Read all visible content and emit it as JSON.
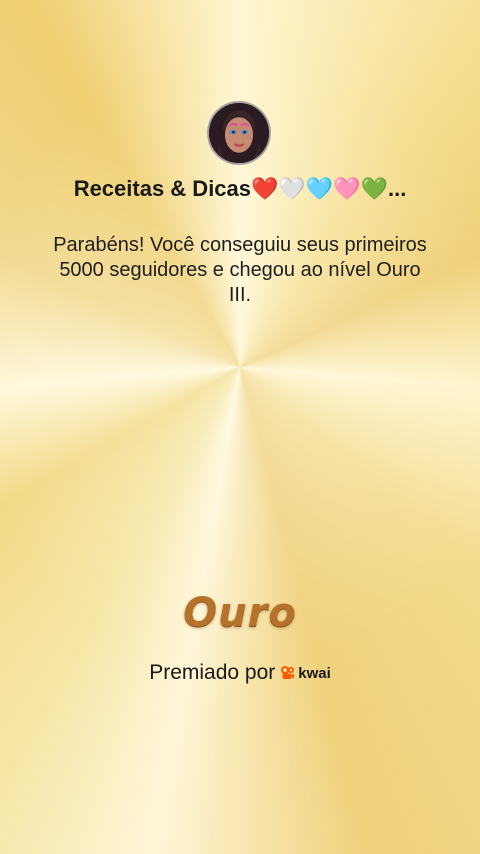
{
  "profile": {
    "name": "Receitas & Dicas❤️🤍🩵🩷💚...",
    "avatar_icon": "profile-photo"
  },
  "message": "Parabéns! Você conseguiu seus primeiros 5000 seguidores e chegou ao nível Ouro III.",
  "badge": {
    "label": "Ouro",
    "color": "#b5722b"
  },
  "footer": {
    "awarded_by": "Premiado por",
    "brand": "kwai",
    "brand_icon": "kwai-logo-icon",
    "brand_color": "#ff5a00"
  }
}
